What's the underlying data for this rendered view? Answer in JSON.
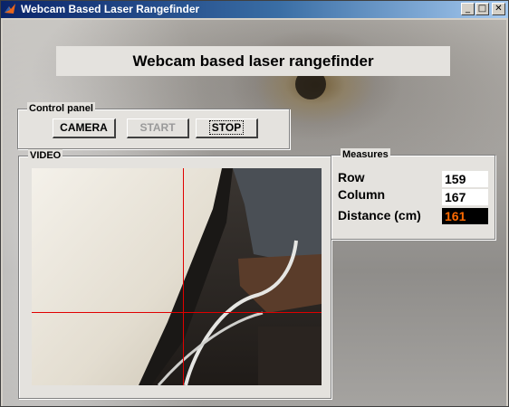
{
  "window": {
    "title": "Webcam Based Laser Rangefinder",
    "controls": {
      "minimize_icon": "minimize-icon",
      "maximize_icon": "maximize-icon",
      "close_icon": "close-icon"
    }
  },
  "banner": {
    "title": "Webcam based laser rangefinder"
  },
  "control_panel": {
    "legend": "Control panel",
    "camera_label": "CAMERA",
    "start_label": "START",
    "stop_label": "STOP"
  },
  "video": {
    "legend": "VIDEO",
    "crosshair_color": "#e00000"
  },
  "measures": {
    "legend": "Measures",
    "row_label": "Row",
    "row_value": "159",
    "column_label": "Column",
    "column_value": "167",
    "distance_label": "Distance (cm)",
    "distance_value": "161",
    "distance_color": "#ff6a00"
  }
}
